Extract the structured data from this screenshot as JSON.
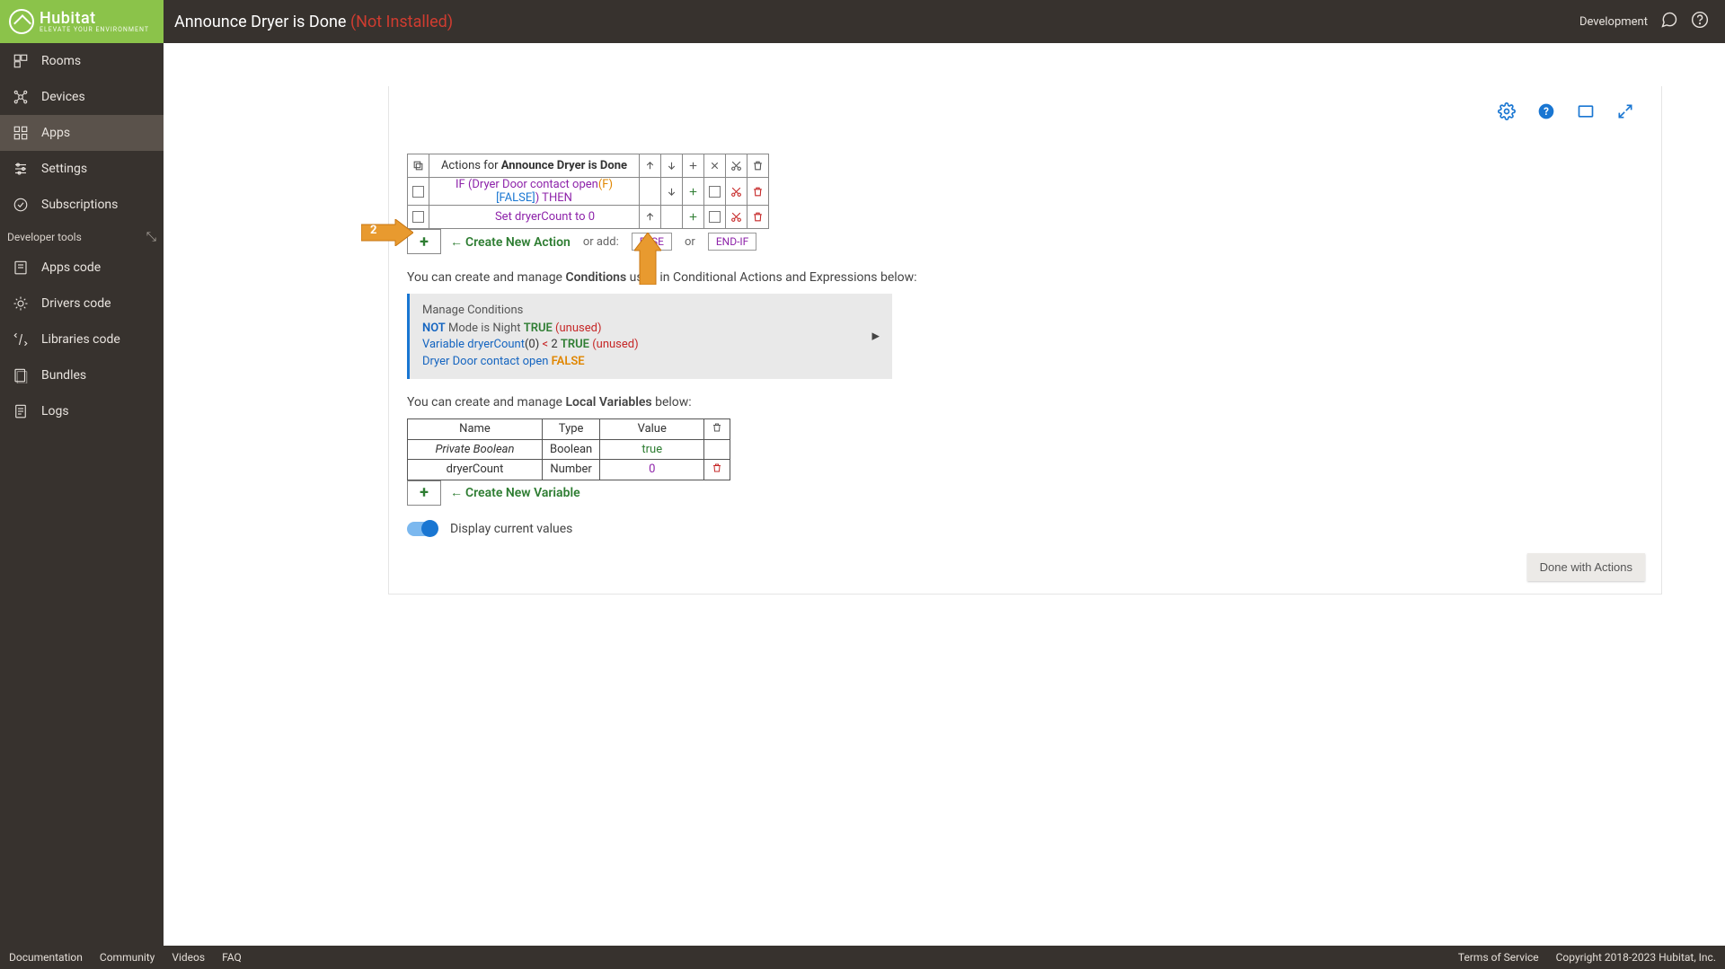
{
  "branding": {
    "name": "Hubitat",
    "tag": "ELEVATE YOUR ENVIRONMENT"
  },
  "header": {
    "title": "Announce Dryer is Done",
    "status": "(Not Installed)",
    "envLabel": "Development"
  },
  "sidebar": {
    "items": [
      {
        "label": "Rooms",
        "icon": "rooms"
      },
      {
        "label": "Devices",
        "icon": "devices"
      },
      {
        "label": "Apps",
        "icon": "apps",
        "active": true
      },
      {
        "label": "Settings",
        "icon": "settings"
      },
      {
        "label": "Subscriptions",
        "icon": "subs"
      }
    ],
    "devHeader": "Developer tools",
    "devItems": [
      {
        "label": "Apps code",
        "icon": "appscode"
      },
      {
        "label": "Drivers code",
        "icon": "drivers"
      },
      {
        "label": "Libraries code",
        "icon": "libs"
      },
      {
        "label": "Bundles",
        "icon": "bundles"
      },
      {
        "label": "Logs",
        "icon": "logs"
      }
    ]
  },
  "actions": {
    "headerPrefix": "Actions for ",
    "headerName": "Announce Dryer is Done",
    "rows": [
      {
        "textPre": "IF (Dryer Door contact open",
        "f": "(F)",
        "fl": " [FALSE]",
        "then": ") THEN"
      },
      {
        "text": "Set dryerCount to 0"
      }
    ],
    "createLabel": "Create New Action",
    "orAdd": "or add:",
    "elseLabel": "ELSE",
    "or": "or",
    "endIfLabel": "END-IF"
  },
  "cond": {
    "descPre": "You can create and manage ",
    "descBold": "Conditions",
    "descPost": " used in Conditional Actions and Expressions below:",
    "title": "Manage Conditions",
    "lines": [
      {
        "not": "NOT",
        "mid": " Mode is Night ",
        "state": "TRUE",
        "unused": " (unused)"
      },
      {
        "var": "Variable dryerCount",
        "paren": "(0) ",
        "op": "< ",
        "n": "2 ",
        "state": "TRUE",
        "unused": " (unused)"
      },
      {
        "var": "Dryer Door contact open ",
        "state": "FALSE"
      }
    ]
  },
  "vars": {
    "descPre": "You can create and manage ",
    "descBold": "Local Variables",
    "descPost": " below:",
    "headers": {
      "name": "Name",
      "type": "Type",
      "value": "Value"
    },
    "rows": [
      {
        "name": "Private Boolean",
        "type": "Boolean",
        "value": "true",
        "trash": false,
        "italic": true,
        "vclass": "vtrue"
      },
      {
        "name": "dryerCount",
        "type": "Number",
        "value": "0",
        "trash": true,
        "italic": false,
        "vclass": "vnum"
      }
    ],
    "createLabel": "Create New Variable"
  },
  "toggleLabel": "Display current values",
  "doneLabel": "Done with Actions",
  "footer": {
    "links": [
      "Documentation",
      "Community",
      "Videos",
      "FAQ"
    ],
    "tos": "Terms of Service",
    "copyright": "Copyright 2018-2023 Hubitat, Inc."
  },
  "annotNumber": "2"
}
